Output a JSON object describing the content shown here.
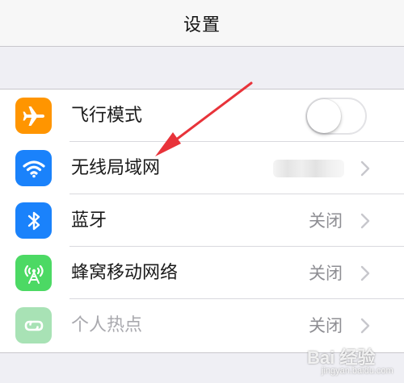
{
  "nav": {
    "title": "设置"
  },
  "colors": {
    "airplane": "#ff9500",
    "wifi": "#1a82fb",
    "bluetooth": "#1a82fb",
    "cellular": "#4cd964",
    "hotspot": "#a8e2b5",
    "annotation_arrow": "#e8333a"
  },
  "settings": {
    "airplane": {
      "label": "飞行模式",
      "icon": "airplane-icon",
      "toggle_on": false
    },
    "wifi": {
      "label": "无线局域网",
      "icon": "wifi-icon",
      "value_hidden": true
    },
    "bluetooth": {
      "label": "蓝牙",
      "icon": "bluetooth-icon",
      "value": "关闭"
    },
    "cellular": {
      "label": "蜂窝移动网络",
      "icon": "cellular-antenna-icon",
      "value": "关闭"
    },
    "hotspot": {
      "label": "个人热点",
      "icon": "hotspot-link-icon",
      "value": "关闭",
      "disabled": true
    }
  },
  "watermark": {
    "main": "Bai 经验",
    "sub": "jingyan.baidu.com"
  }
}
